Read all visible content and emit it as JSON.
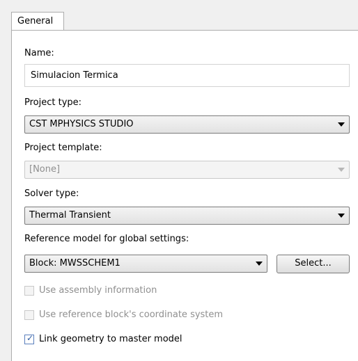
{
  "tabs": [
    {
      "label": "General"
    }
  ],
  "name": {
    "label": "Name:",
    "value": "Simulacion Termica"
  },
  "project_type": {
    "label": "Project type:",
    "value": "CST MPHYSICS STUDIO"
  },
  "project_template": {
    "label": "Project template:",
    "value": "[None]"
  },
  "solver_type": {
    "label": "Solver type:",
    "value": "Thermal Transient"
  },
  "reference_model": {
    "label": "Reference model for global settings:",
    "value": "Block: MWSSCHEM1",
    "select_button": "Select..."
  },
  "options": {
    "use_assembly": {
      "label": "Use assembly information",
      "checked": false,
      "enabled": false
    },
    "use_ref_coords": {
      "label": "Use reference block's coordinate system",
      "checked": false,
      "enabled": false
    },
    "link_geometry": {
      "label": "Link geometry to master model",
      "checked": true,
      "enabled": true
    }
  }
}
